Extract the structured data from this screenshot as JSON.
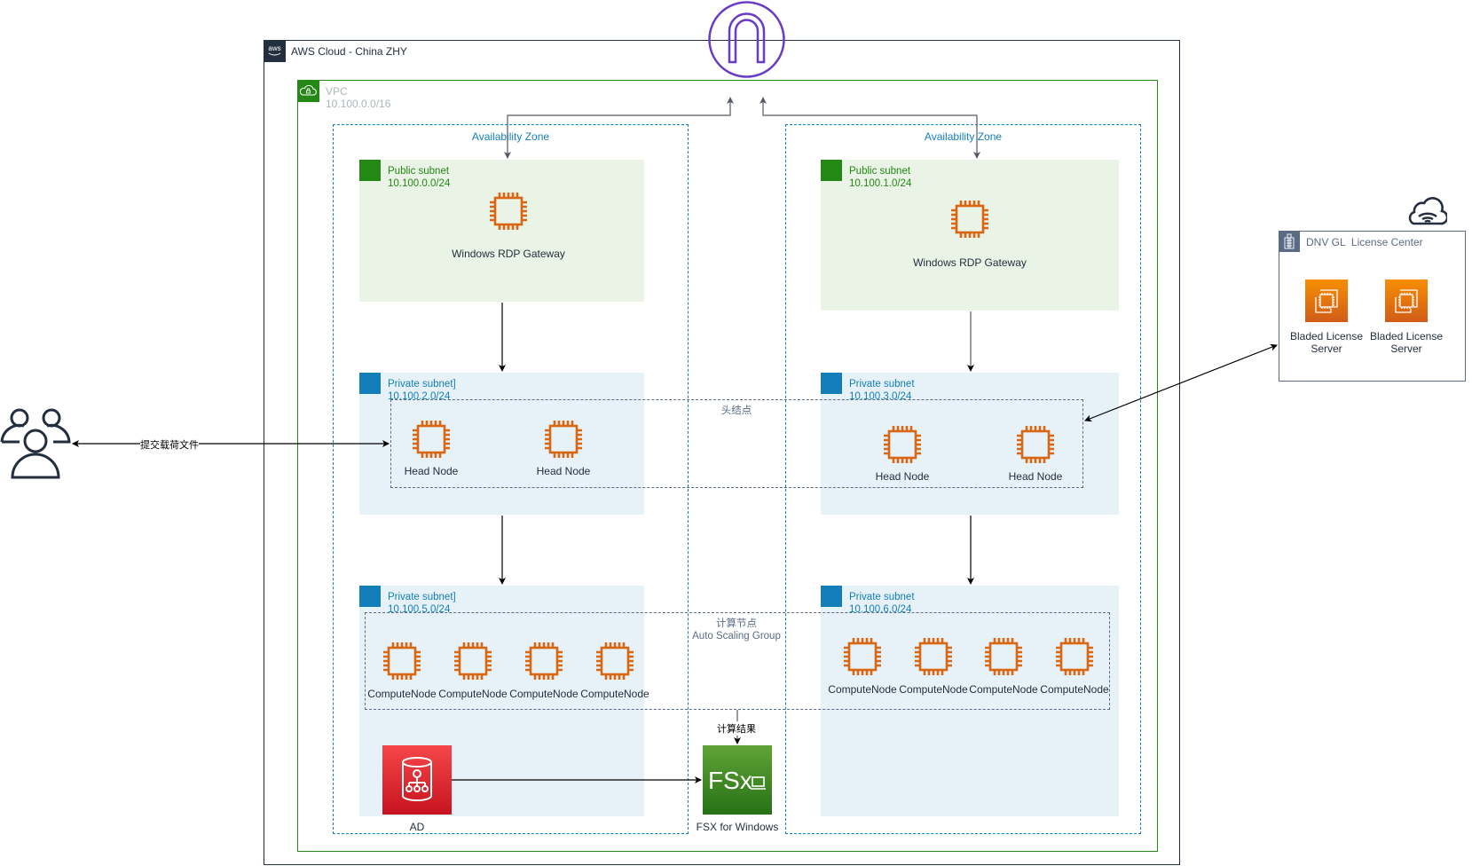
{
  "aws_cloud": {
    "title": "AWS Cloud - China ZHY",
    "icon": "aws-logo-icon"
  },
  "vpc": {
    "title": "VPC",
    "cidr": "10.100.0.0/16",
    "icon": "vpc-cloud-lock-icon"
  },
  "internet_gateway": {
    "icon": "internet-gateway-icon"
  },
  "availability_zones": [
    {
      "label": "Availability Zone",
      "public_subnet": {
        "title": "Public subnet",
        "cidr": "10.100.0.0/24",
        "instance": "Windows RDP Gateway"
      },
      "head_subnet": {
        "title": "Private subnet]",
        "cidr": "10.100.2.0/24",
        "nodes": [
          "Head Node",
          "Head Node"
        ]
      },
      "compute_subnet": {
        "title": "Private subnet]",
        "cidr": "10.100.5.0/24",
        "nodes": [
          "ComputeNode",
          "ComputeNode",
          "ComputeNode",
          "ComputeNode"
        ]
      }
    },
    {
      "label": "Availability Zone",
      "public_subnet": {
        "title": "Public subnet",
        "cidr": "10.100.1.0/24",
        "instance": "Windows RDP Gateway"
      },
      "head_subnet": {
        "title": "Private subnet",
        "cidr": "10.100.3.0/24",
        "nodes": [
          "Head Node",
          "Head Node"
        ]
      },
      "compute_subnet": {
        "title": "Private subnet",
        "cidr": "10.100.6.0/24",
        "nodes": [
          "ComputeNode",
          "ComputeNode",
          "ComputeNode",
          "ComputeNode"
        ]
      }
    }
  ],
  "groups": {
    "head": {
      "label": "头结点"
    },
    "compute": {
      "label": "计算节点\nAuto Scaling Group"
    }
  },
  "services": {
    "ad": {
      "label": "AD",
      "icon": "directory-service-icon",
      "color": "#d6242d"
    },
    "fsx": {
      "label": "FSX for Windows",
      "icon": "fsx-windows-icon",
      "color": "#3f8624"
    }
  },
  "users": {
    "icon": "users-icon"
  },
  "edges": {
    "users_to_head": "提交载荷文件",
    "compute_to_fsx": "计算结果"
  },
  "license_center": {
    "title": "DNV GL  License Center",
    "icon": "corporate-datacenter-icon",
    "cloud_icon": "internet-cloud-icon",
    "servers": [
      "Bladed License\nServer",
      "Bladed License\nServer"
    ]
  },
  "colors": {
    "aws_dark": "#232f3e",
    "vpc_green": "#248814",
    "az_blue": "#147eba",
    "ec2_orange": "#d86613",
    "igw_purple": "#693cc5",
    "public_bg": "#e9f3e6",
    "private_bg": "#e6f2f8"
  }
}
